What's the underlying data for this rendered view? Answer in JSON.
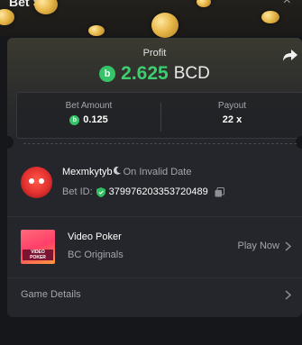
{
  "header": {
    "title": "Bet Slip",
    "close_label": "×"
  },
  "profit": {
    "label": "Profit",
    "value": "2.625",
    "currency": "BCD",
    "coin_icon": "bcd-coin-icon",
    "value_color": "#3bcf6f"
  },
  "bet_amount": {
    "label": "Bet Amount",
    "value": "0.125"
  },
  "payout": {
    "label": "Payout",
    "value": "22 x"
  },
  "user": {
    "name": "Mexmkytyb",
    "date": "On Invalid Date",
    "bet_id_label": "Bet ID:",
    "bet_id": "379976203353720489"
  },
  "game": {
    "name": "Video Poker",
    "provider": "BC Originals",
    "play_label": "Play Now",
    "thumb_label": "VIDEO POKER"
  },
  "details": {
    "label": "Game Details"
  },
  "icons": {
    "share": "share-icon",
    "shield": "shield-icon",
    "copy": "copy-icon",
    "chevron": "chevron-right-icon",
    "moon": "moon-icon"
  }
}
